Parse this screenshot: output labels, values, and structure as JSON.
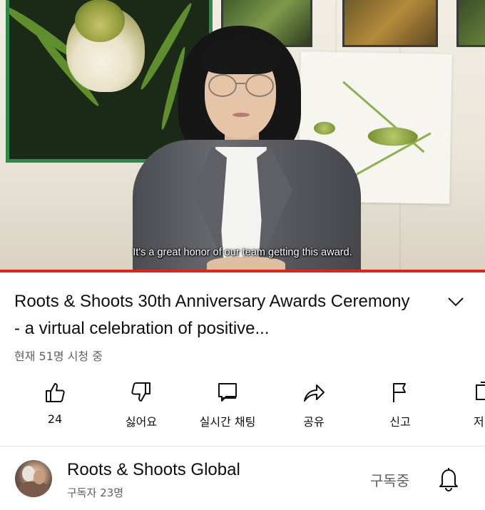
{
  "video": {
    "subtitle": "It's a great honor of our team getting this award.",
    "progress_fraction": 1.0,
    "progress_color": "#e62117"
  },
  "info": {
    "title": "Roots & Shoots 30th Anniversary Awards Ceremony - a virtual celebration of positive...",
    "views": "현재 51명 시청 중"
  },
  "actions": [
    {
      "icon": "thumbs-up-icon",
      "label": "24"
    },
    {
      "icon": "thumbs-down-icon",
      "label": "싫어요"
    },
    {
      "icon": "live-chat-icon",
      "label": "실시간 채팅"
    },
    {
      "icon": "share-icon",
      "label": "공유"
    },
    {
      "icon": "flag-icon",
      "label": "신고"
    },
    {
      "icon": "save-icon",
      "label": "저"
    }
  ],
  "channel": {
    "name": "Roots & Shoots Global",
    "subscribers": "구독자 23명",
    "subscribed_label": "구독중"
  },
  "colors": {
    "text_primary": "#0f0f0f",
    "text_secondary": "#606060",
    "accent_red": "#e62117"
  }
}
